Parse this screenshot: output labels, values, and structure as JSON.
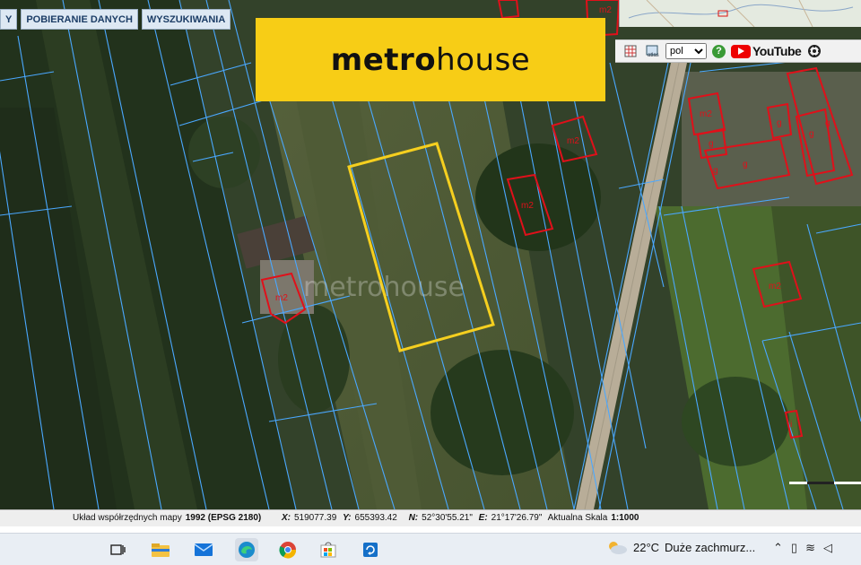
{
  "menu": {
    "items": [
      {
        "label": "Y"
      },
      {
        "label": "POBIERANIE DANYCH"
      },
      {
        "label": "WYSZUKIWANIA"
      }
    ]
  },
  "brand": {
    "bold": "metro",
    "light": "house"
  },
  "watermark": "metrohouse",
  "toolbar": {
    "language": "pol",
    "help_label": "?",
    "youtube_label": "YouTube",
    "icons": [
      "grid-icon",
      "atlas-icon",
      "help-icon",
      "youtube-icon",
      "settings-icon"
    ]
  },
  "building_labels": [
    "m2",
    "m2",
    "m2",
    "m2",
    "m2",
    "m2",
    "g",
    "g",
    "g",
    "g",
    "g",
    "g",
    "i"
  ],
  "status": {
    "crs_prefix": "Układ współrzędnych mapy",
    "crs_value": "1992 (EPSG 2180)",
    "x_label": "X:",
    "x_value": "519077.39",
    "y_label": "Y:",
    "y_value": "655393.42",
    "n_label": "N:",
    "n_value": "52°30'55.21\"",
    "e_label": "E:",
    "e_value": "21°17'26.79\"",
    "scale_label": "Aktualna Skala",
    "scale_value": "1:1000"
  },
  "taskbar": {
    "apps": [
      "task-view-icon",
      "file-explorer-icon",
      "mail-icon",
      "edge-icon",
      "chrome-icon",
      "store-icon",
      "remote-icon"
    ],
    "weather_temp": "22°C",
    "weather_desc": "Duże zachmurz..."
  },
  "colors": {
    "parcel_lines": "#4aa8ff",
    "building_outline": "#e0101a",
    "selected_plot": "#f5cf1f",
    "brand_yellow": "#f7cd16"
  }
}
